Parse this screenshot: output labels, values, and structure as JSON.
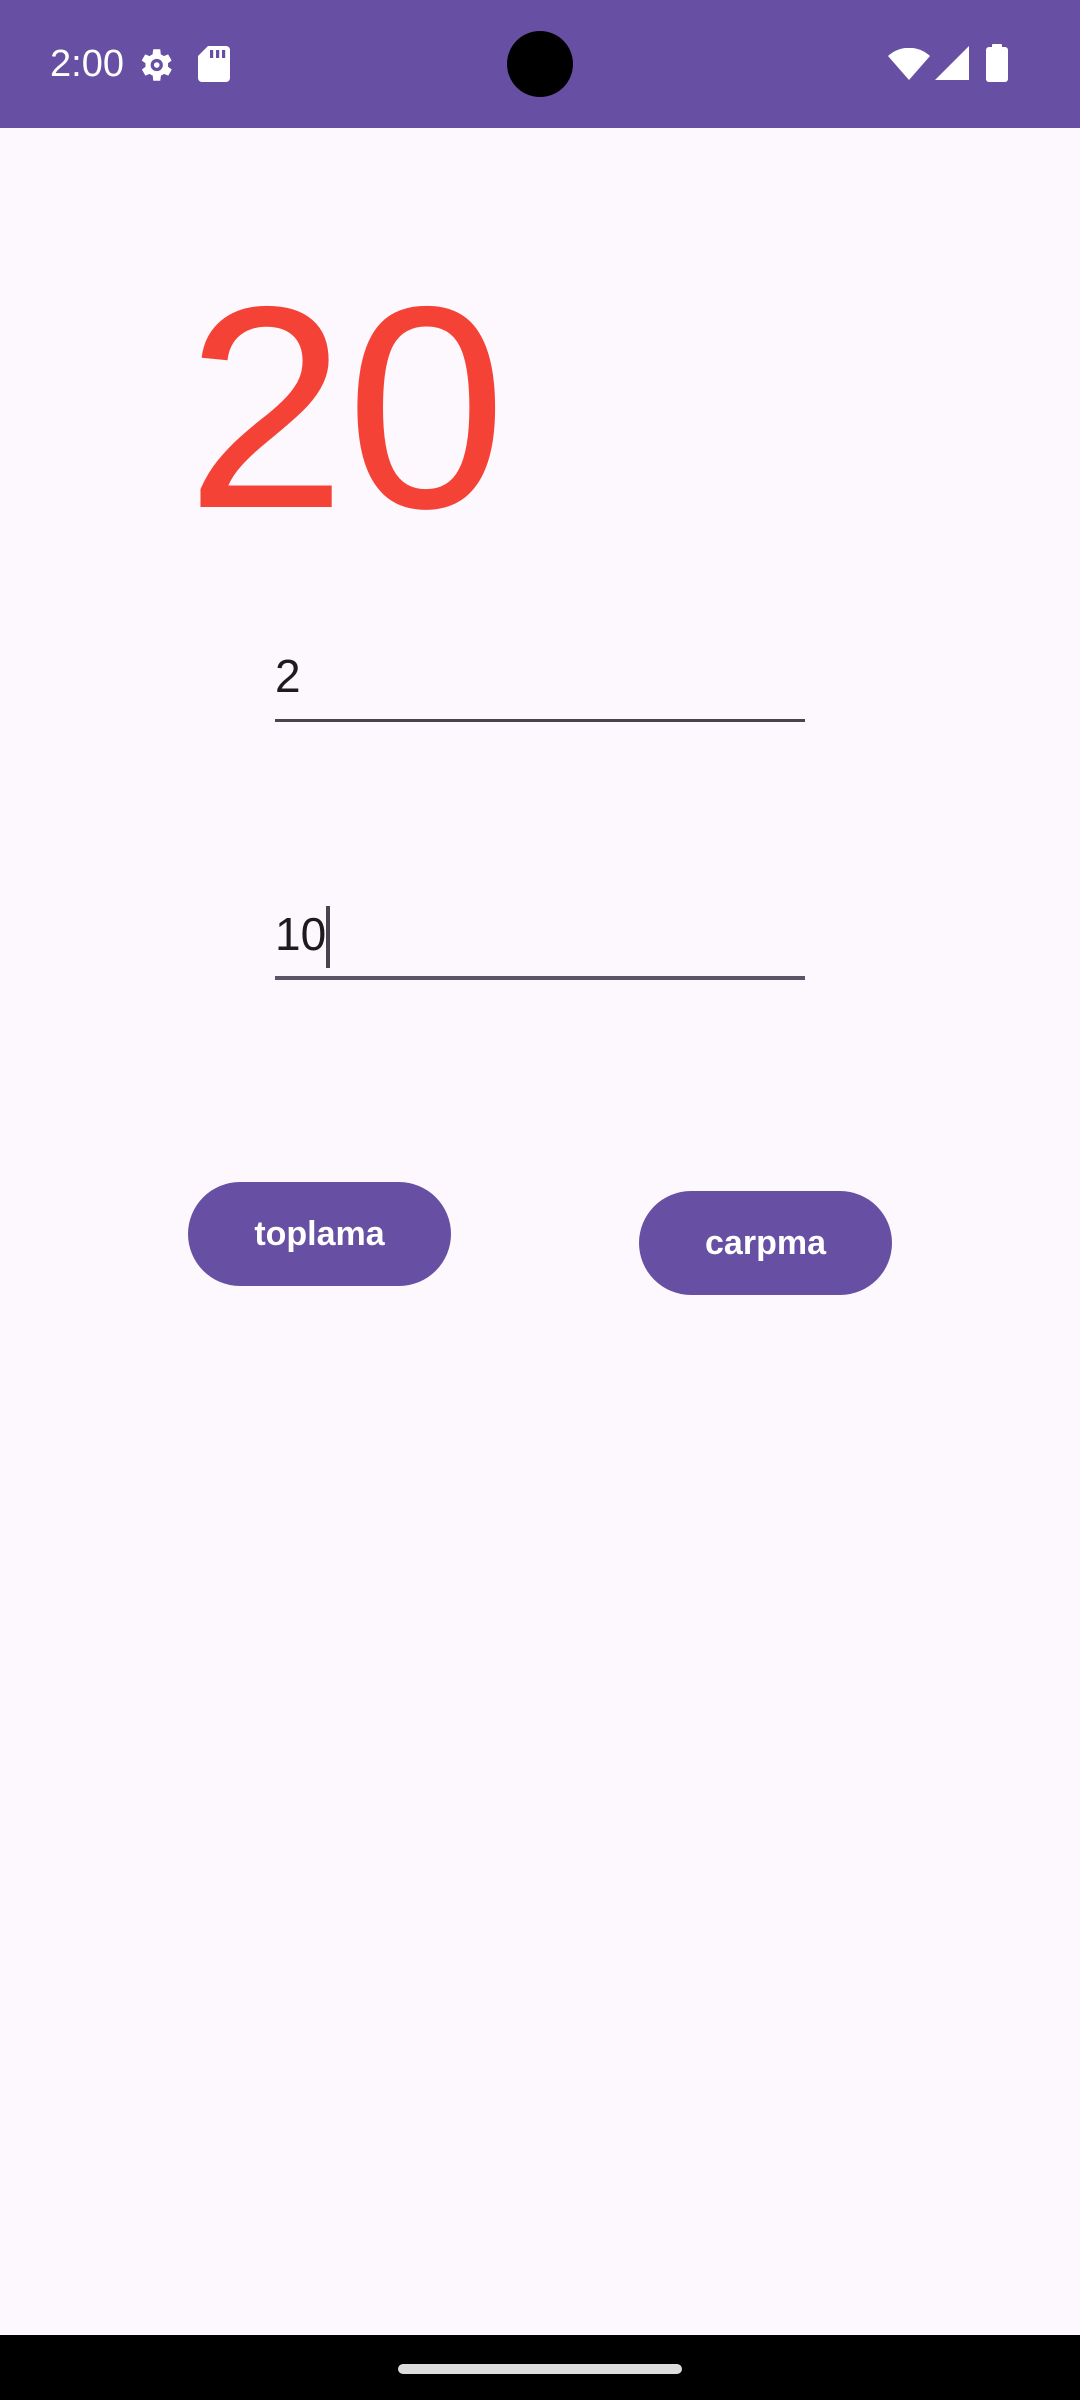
{
  "status_bar": {
    "time": "2:00",
    "icons": [
      "gear-icon",
      "sd-card-icon",
      "wifi-icon",
      "signal-icon",
      "battery-icon"
    ],
    "background": "#6750A4"
  },
  "result": {
    "value": "20",
    "color": "#F44336"
  },
  "inputs": {
    "first": {
      "value": "2"
    },
    "second": {
      "value": "10"
    }
  },
  "buttons": {
    "toplama_label": "toplama",
    "carpma_label": "carpma",
    "color": "#6750A4"
  },
  "navigation": {
    "handle": "gesture-handle"
  }
}
